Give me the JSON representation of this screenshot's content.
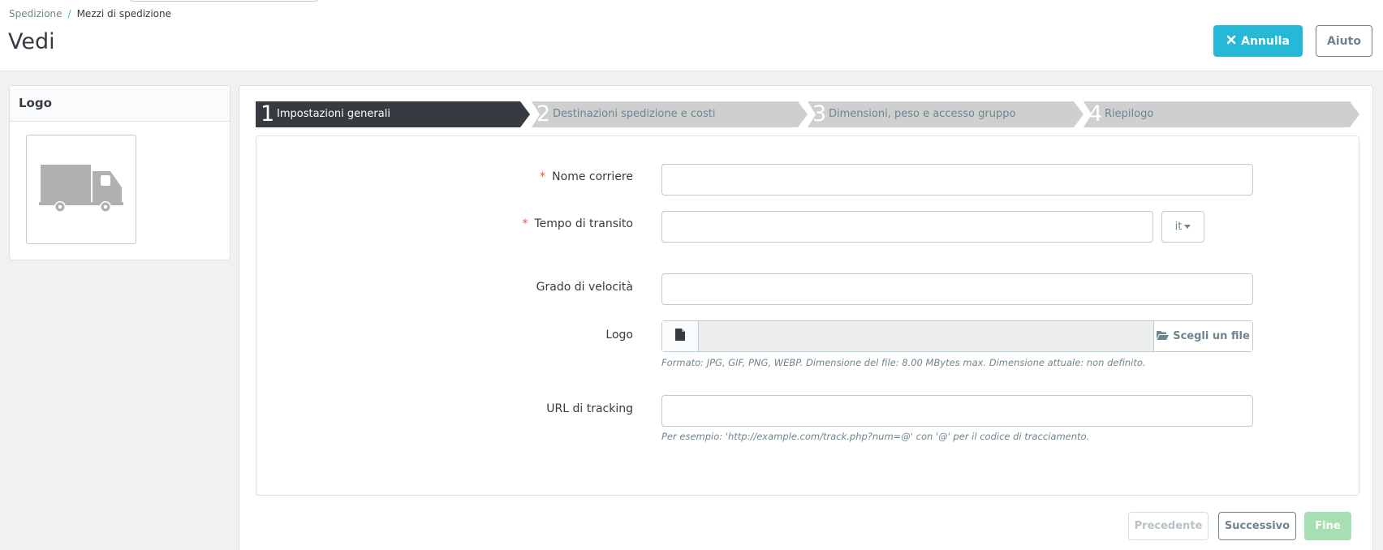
{
  "breadcrumb": {
    "parent": "Spedizione",
    "separator": "/",
    "current": "Mezzi di spedizione"
  },
  "page": {
    "title": "Vedi"
  },
  "toolbar": {
    "cancel_label": "Annulla",
    "help_label": "Aiuto"
  },
  "sidebar": {
    "title": "Logo",
    "logo_icon": "truck-icon"
  },
  "wizard": {
    "steps": [
      {
        "number": "1",
        "label": "Impostazioni generali",
        "active": true
      },
      {
        "number": "2",
        "label": "Destinazioni spedizione e costi",
        "active": false
      },
      {
        "number": "3",
        "label": "Dimensioni, peso e accesso gruppo",
        "active": false
      },
      {
        "number": "4",
        "label": "Riepilogo",
        "active": false
      }
    ]
  },
  "form": {
    "required_mark": "*",
    "carrier_name": {
      "label": "Nome corriere",
      "value": ""
    },
    "transit_time": {
      "label": "Tempo di transito",
      "value": "",
      "language": "it"
    },
    "speed_grade": {
      "label": "Grado di velocità",
      "value": ""
    },
    "logo": {
      "label": "Logo",
      "file_name": "",
      "choose_label": "Scegli un file",
      "help": "Formato: JPG, GIF, PNG, WEBP. Dimensione del file: 8.00 MBytes max. Dimensione attuale: non definito."
    },
    "tracking_url": {
      "label": "URL di tracking",
      "value": "",
      "help": "Per esempio: 'http://example.com/track.php?num=@' con '@' per il codice di tracciamento."
    }
  },
  "footer": {
    "prev_label": "Precedente",
    "next_label": "Successivo",
    "finish_label": "Fine"
  },
  "colors": {
    "accent": "#25b9d7",
    "active_step": "#363a41",
    "inactive_step": "#cfcfcf",
    "success": "#a6dfb4",
    "required": "#f54c3e"
  }
}
